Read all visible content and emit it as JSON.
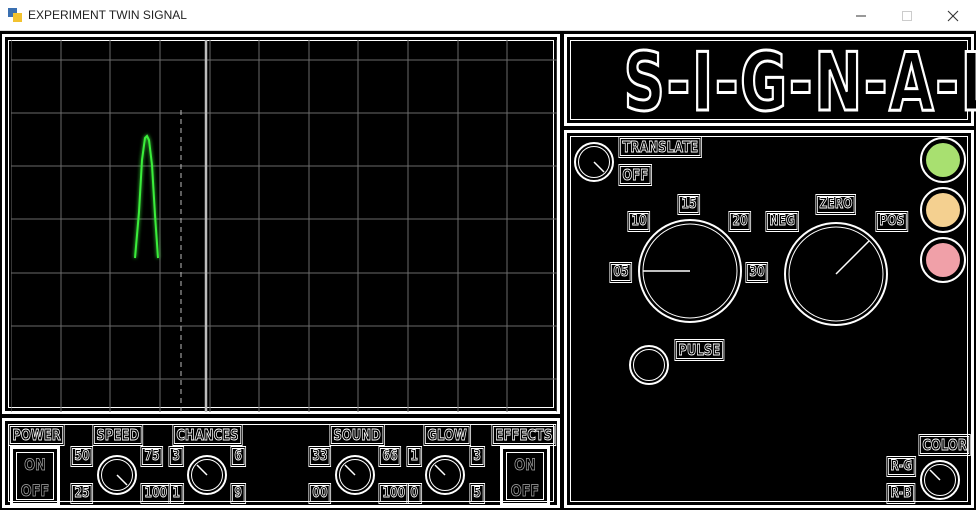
{
  "window": {
    "title": "EXPERIMENT TWIN SIGNAL"
  },
  "logo": {
    "text": "S-I-G-N-A-L"
  },
  "oscilloscope": {
    "grid": true,
    "colors": {
      "grid": "#6a6a6a",
      "red_trace": "#ff3030",
      "yellow_trace": "#ffee00",
      "green_signal": "#30e030",
      "marker": "#aaaaaa"
    }
  },
  "controls": {
    "power": {
      "label": "POWER",
      "on": "ON",
      "off": "OFF"
    },
    "speed": {
      "label": "SPEED",
      "ticks": [
        "50",
        "75",
        "25",
        "100"
      ]
    },
    "chances": {
      "label": "CHANCES",
      "ticks": [
        "3",
        "6",
        "1",
        "9"
      ]
    },
    "sound": {
      "label": "SOUND",
      "ticks": [
        "33",
        "66",
        "00",
        "100"
      ]
    },
    "glow": {
      "label": "GLOW",
      "ticks": [
        "1",
        "3",
        "0",
        "5"
      ]
    },
    "effects": {
      "label": "EFFECTS",
      "on": "ON",
      "off": "OFF"
    }
  },
  "right": {
    "translate": {
      "label": "TRANSLATE",
      "value": "OFF"
    },
    "freq": {
      "ticks": [
        "05",
        "10",
        "15",
        "20",
        "30"
      ]
    },
    "zero": {
      "label": "ZERO",
      "neg": "NEG",
      "pos": "POS"
    },
    "pulse": {
      "label": "PULSE"
    },
    "color": {
      "label": "COLOR",
      "rg": "R-G",
      "rb": "R-B"
    },
    "lamps": [
      {
        "name": "green",
        "color": "#a8e070"
      },
      {
        "name": "orange",
        "color": "#f4d090"
      },
      {
        "name": "red",
        "color": "#f0a0a8"
      }
    ]
  }
}
